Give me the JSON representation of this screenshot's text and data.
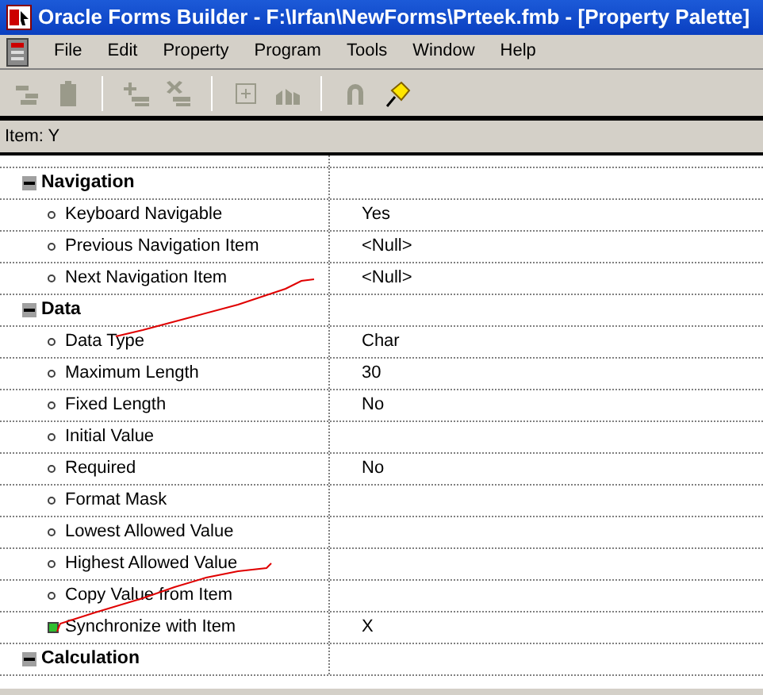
{
  "window": {
    "title": "Oracle Forms Builder - F:\\Irfan\\NewForms\\Prteek.fmb - [Property Palette]"
  },
  "menu": [
    "File",
    "Edit",
    "Property",
    "Program",
    "Tools",
    "Window",
    "Help"
  ],
  "toolbar": [
    {
      "disabled": true
    },
    {
      "disabled": true
    },
    {
      "disabled": true
    },
    {
      "disabled": true
    },
    {
      "disabled": true
    },
    {
      "disabled": true
    },
    {
      "disabled": true
    },
    {
      "disabled": false
    }
  ],
  "item_label": "Item: Y",
  "properties": [
    {
      "kind": "category",
      "name": "Navigation",
      "expanded": true,
      "children": [
        {
          "kind": "property",
          "name": "Keyboard Navigable",
          "value": "Yes",
          "changed": false
        },
        {
          "kind": "property",
          "name": "Previous Navigation Item",
          "value": "<Null>",
          "changed": false
        },
        {
          "kind": "property",
          "name": "Next Navigation Item",
          "value": "<Null>",
          "changed": false
        }
      ]
    },
    {
      "kind": "category",
      "name": "Data",
      "expanded": true,
      "children": [
        {
          "kind": "property",
          "name": "Data Type",
          "value": "Char",
          "changed": false
        },
        {
          "kind": "property",
          "name": "Maximum Length",
          "value": "30",
          "changed": false
        },
        {
          "kind": "property",
          "name": "Fixed Length",
          "value": "No",
          "changed": false
        },
        {
          "kind": "property",
          "name": "Initial Value",
          "changed": false
        },
        {
          "kind": "property",
          "name": "Required",
          "value": "No",
          "changed": false
        },
        {
          "kind": "property",
          "name": "Format Mask",
          "changed": false
        },
        {
          "kind": "property",
          "name": "Lowest Allowed Value",
          "changed": false
        },
        {
          "kind": "property",
          "name": "Highest Allowed Value",
          "changed": false
        },
        {
          "kind": "property",
          "name": "Copy Value from Item",
          "changed": false
        },
        {
          "kind": "property",
          "name": "Synchronize with Item",
          "value": "X",
          "changed": true
        }
      ]
    },
    {
      "kind": "category",
      "name": "Calculation",
      "expanded": true
    }
  ]
}
